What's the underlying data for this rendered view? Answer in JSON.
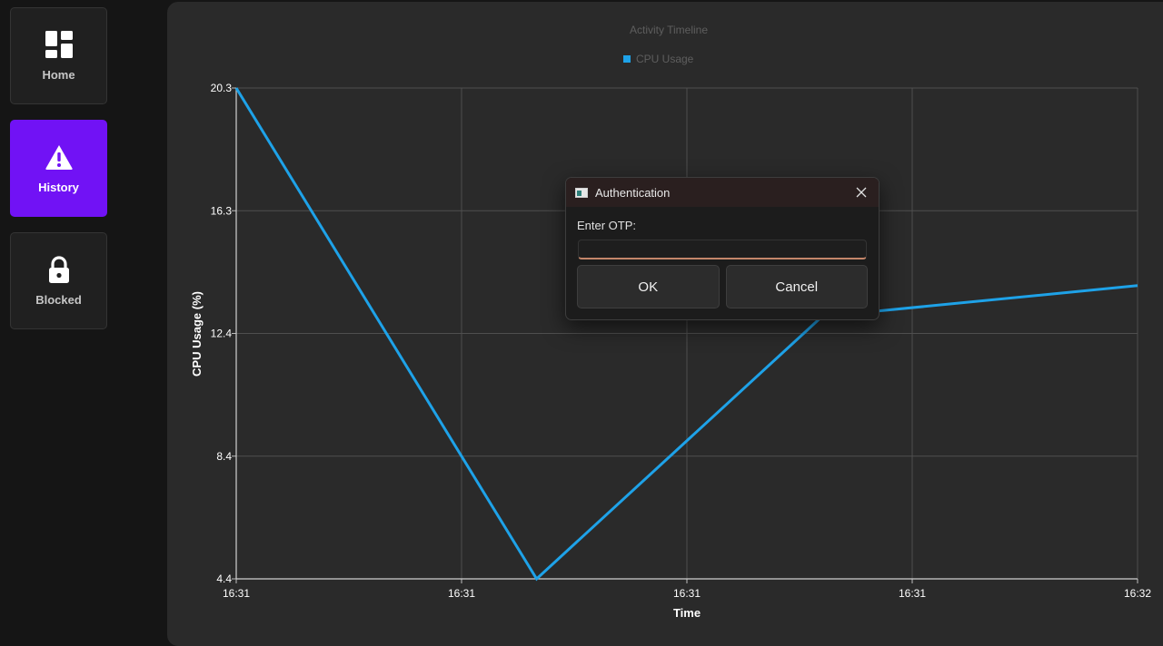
{
  "sidebar": {
    "items": [
      {
        "label": "Home",
        "icon": "dashboard-icon",
        "active": false
      },
      {
        "label": "History",
        "icon": "warning-icon",
        "active": true
      },
      {
        "label": "Blocked",
        "icon": "lock-icon",
        "active": false
      }
    ],
    "accent_color": "#7112f5"
  },
  "chart_data": {
    "type": "line",
    "title": "Activity Timeline",
    "xlabel": "Time",
    "ylabel": "CPU Usage (%)",
    "x_tick_labels": [
      "16:31",
      "16:31",
      "16:31",
      "16:31",
      "16:32"
    ],
    "y_tick_labels": [
      "4.4",
      "8.4",
      "12.4",
      "16.3",
      "20.3"
    ],
    "ylim": [
      4.4,
      20.3
    ],
    "grid": true,
    "legend_position": "top-center",
    "series": [
      {
        "name": "CPU Usage",
        "color": "#1ea2e8",
        "points": [
          {
            "x": 0.0,
            "y": 20.3
          },
          {
            "x": 1.333,
            "y": 4.4
          },
          {
            "x": 2.6,
            "y": 12.9
          },
          {
            "x": 4.0,
            "y": 13.9
          }
        ]
      }
    ]
  },
  "dialog": {
    "title": "Authentication",
    "prompt": "Enter OTP:",
    "input_value": "",
    "ok_label": "OK",
    "cancel_label": "Cancel",
    "close_icon": "close-icon",
    "app_icon": "window-icon"
  }
}
